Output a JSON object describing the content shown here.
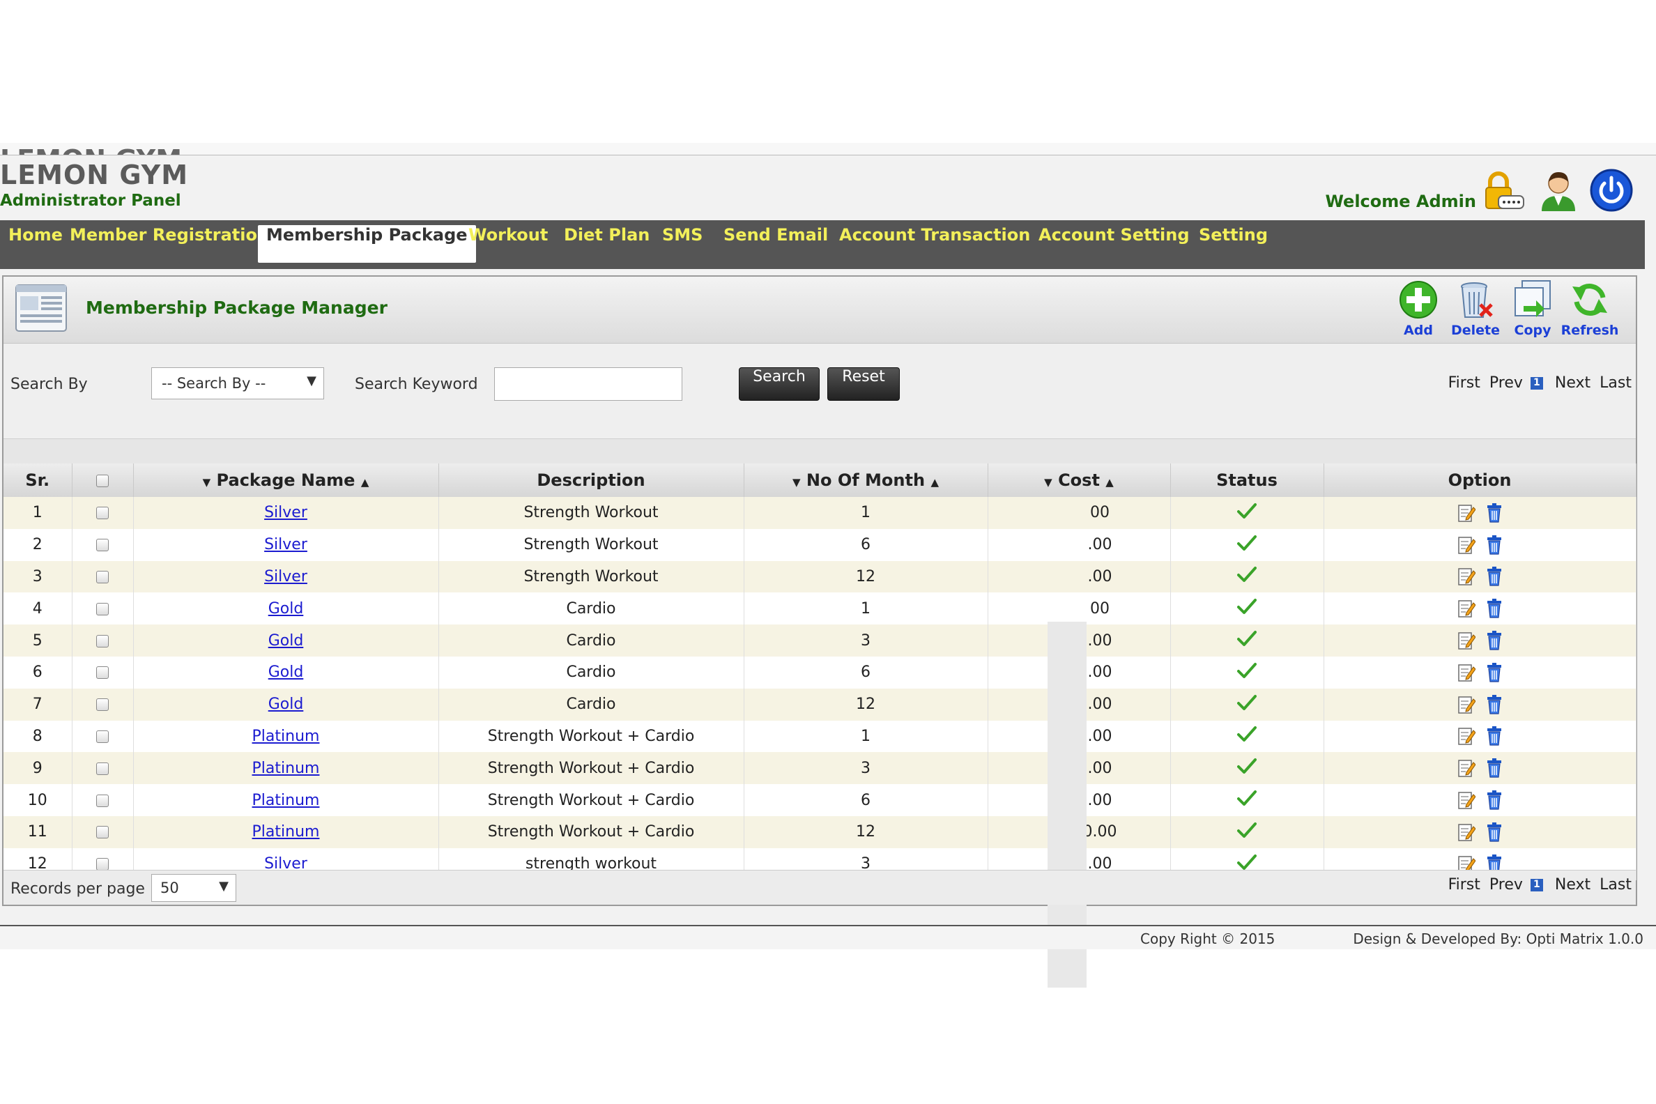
{
  "brand": {
    "title": "LEMON GYM",
    "subtitle": "Administrator Panel",
    "welcome": "Welcome Admin"
  },
  "nav": [
    "Home",
    "Member Registration",
    "Membership Package",
    "Workout",
    "Diet Plan",
    "SMS",
    "Send Email",
    "Account Transaction",
    "Account Setting",
    "Setting"
  ],
  "nav_active": "Membership Package",
  "panel": {
    "title": "Membership Package Manager"
  },
  "toolbar": {
    "add": "Add",
    "delete": "Delete",
    "copy": "Copy",
    "refresh": "Refresh"
  },
  "search": {
    "by_label": "Search By",
    "by_value": "-- Search By --",
    "keyword_label": "Search Keyword",
    "keyword_value": "",
    "search_btn": "Search",
    "reset_btn": "Reset"
  },
  "pager": {
    "first": "First",
    "prev": "Prev",
    "current": "1",
    "next": "Next",
    "last": "Last"
  },
  "columns": {
    "sr": "Sr.",
    "package": "Package Name",
    "description": "Description",
    "months": "No Of Month",
    "cost": "Cost",
    "status": "Status",
    "option": "Option"
  },
  "rows": [
    {
      "sr": "1",
      "package": "Silver",
      "description": "Strength Workout",
      "months": "1",
      "cost": "00"
    },
    {
      "sr": "2",
      "package": "Silver",
      "description": "Strength Workout",
      "months": "6",
      "cost": ".00"
    },
    {
      "sr": "3",
      "package": "Silver",
      "description": "Strength Workout",
      "months": "12",
      "cost": ".00"
    },
    {
      "sr": "4",
      "package": "Gold",
      "description": "Cardio",
      "months": "1",
      "cost": "00"
    },
    {
      "sr": "5",
      "package": "Gold",
      "description": "Cardio",
      "months": "3",
      "cost": ".00"
    },
    {
      "sr": "6",
      "package": "Gold",
      "description": "Cardio",
      "months": "6",
      "cost": ".00"
    },
    {
      "sr": "7",
      "package": "Gold",
      "description": "Cardio",
      "months": "12",
      "cost": ".00"
    },
    {
      "sr": "8",
      "package": "Platinum",
      "description": "Strength Workout + Cardio",
      "months": "1",
      "cost": ".00"
    },
    {
      "sr": "9",
      "package": "Platinum",
      "description": "Strength Workout + Cardio",
      "months": "3",
      "cost": ".00"
    },
    {
      "sr": "10",
      "package": "Platinum",
      "description": "Strength Workout + Cardio",
      "months": "6",
      "cost": ".00"
    },
    {
      "sr": "11",
      "package": "Platinum",
      "description": "Strength Workout + Cardio",
      "months": "12",
      "cost": "0.00"
    },
    {
      "sr": "12",
      "package": "Silver",
      "description": "strength workout",
      "months": "3",
      "cost": ".00"
    }
  ],
  "records": {
    "label": "Records per page :",
    "value": "50"
  },
  "footer": {
    "copyright": "Copy Right © 2015",
    "developer": "Design & Developed By: Opti Matrix 1.0.0"
  },
  "icons": {
    "lock": "lock-icon",
    "user": "admin-user-icon",
    "power": "power-icon",
    "add": "add-icon",
    "delete": "trash-icon",
    "copy": "copy-icon",
    "refresh": "refresh-icon",
    "status": "check-icon",
    "edit": "edit-icon",
    "row_delete": "trash-icon"
  },
  "colors": {
    "brand_green": "#1f6b12",
    "nav_bg": "#555555",
    "nav_text": "#f3f05a",
    "link": "#1b1bd0",
    "row_odd": "#f6f3e3"
  }
}
